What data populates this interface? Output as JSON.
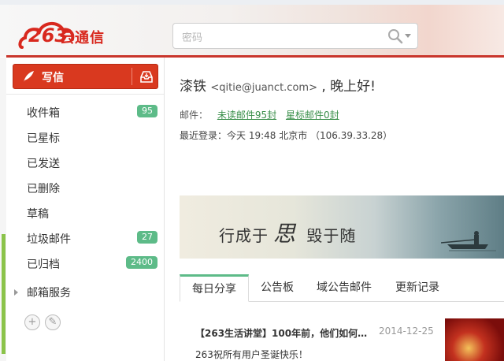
{
  "header": {
    "logo_number": "263",
    "logo_text": "云通信",
    "search_placeholder": "密码"
  },
  "sidebar": {
    "compose_label": "写信",
    "folders": [
      {
        "label": "收件箱",
        "badge": "95"
      },
      {
        "label": "已星标",
        "badge": ""
      },
      {
        "label": "已发送",
        "badge": ""
      },
      {
        "label": "已删除",
        "badge": ""
      },
      {
        "label": "草稿",
        "badge": ""
      },
      {
        "label": "垃圾邮件",
        "badge": "27"
      },
      {
        "label": "已归档",
        "badge": "2400"
      },
      {
        "label": "邮箱服务",
        "badge": ""
      }
    ],
    "add_symbol": "+",
    "settings_symbol": "✎"
  },
  "greeting": {
    "name": "漆铁",
    "email": "<qitie@juanct.com>",
    "suffix": ", 晚上好!"
  },
  "mail_info": {
    "label": "邮件：",
    "unread_link": "未读邮件95封",
    "starred_link": "星标邮件0封"
  },
  "last_login": "最近登录：今天 19:48 北京市 （106.39.33.28）",
  "banner": {
    "text_before": "行成于",
    "text_big": "思",
    "text_after": "毁于随"
  },
  "tabs": [
    {
      "label": "每日分享",
      "active": true
    },
    {
      "label": "公告板",
      "active": false
    },
    {
      "label": "域公告邮件",
      "active": false
    },
    {
      "label": "更新记录",
      "active": false
    }
  ],
  "news": {
    "title": "【263生活讲堂】100年前，他们如何…",
    "date": "2014-12-25",
    "body": "263祝所有用户圣诞快乐！"
  },
  "colors": {
    "accent_red": "#d9391f",
    "badge_green": "#5dbb88",
    "link_green": "#3a8f4a"
  }
}
